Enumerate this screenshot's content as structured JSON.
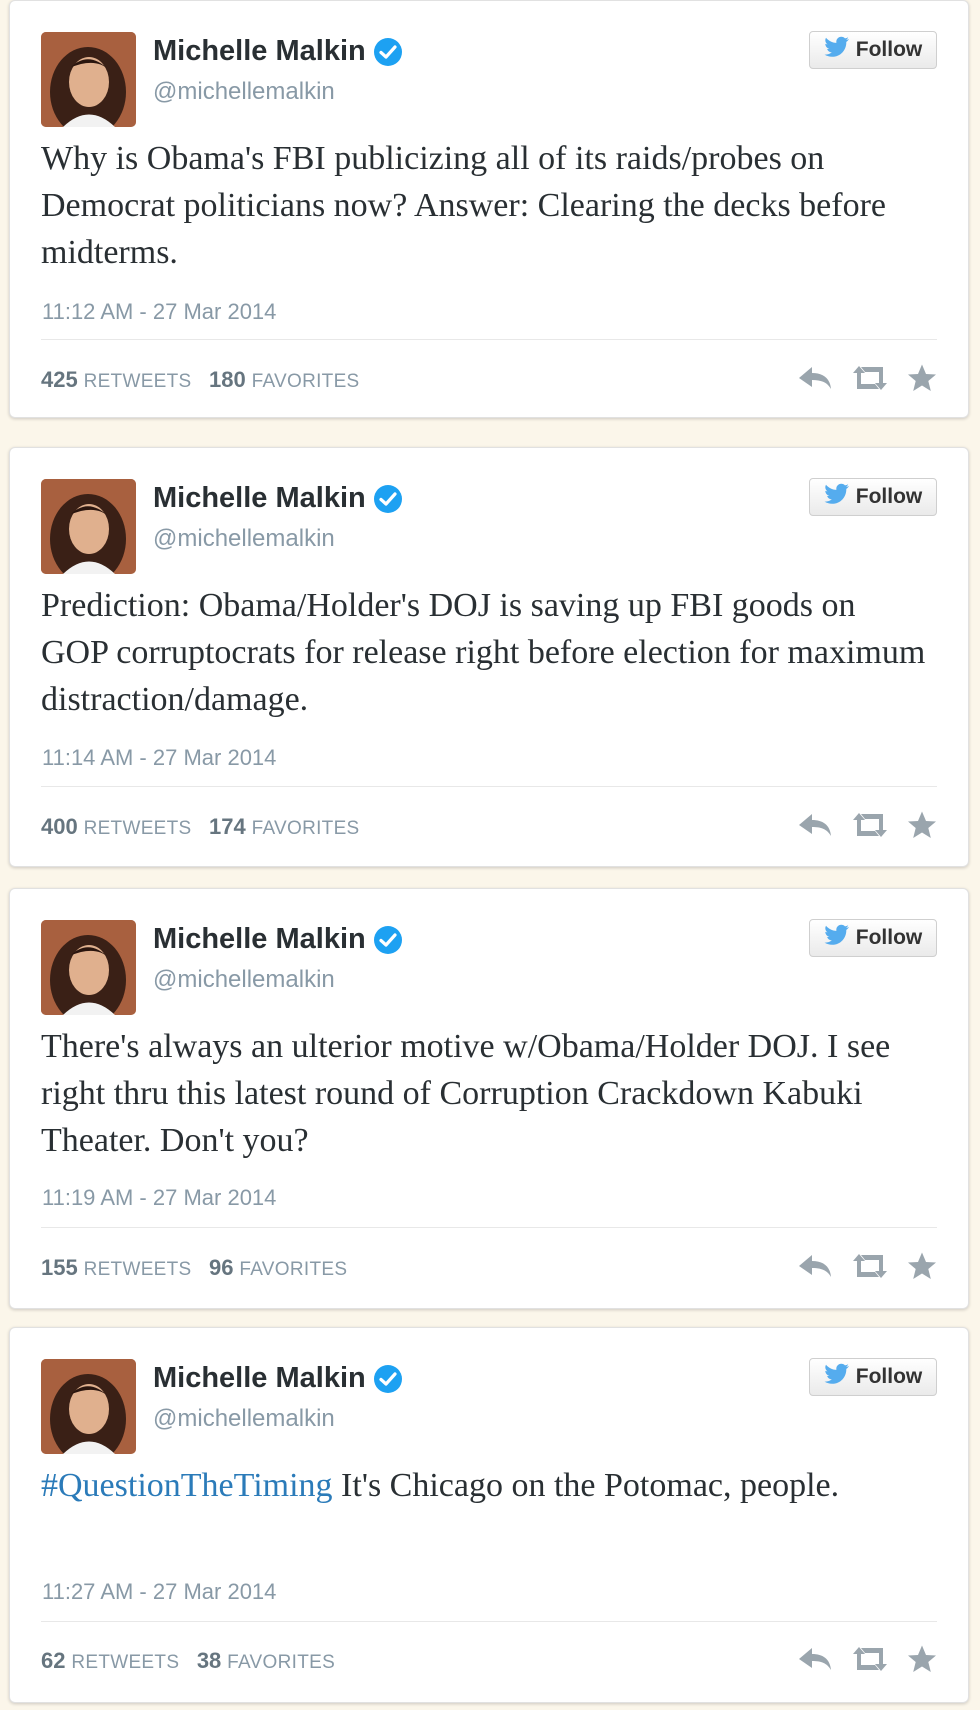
{
  "tweets": [
    {
      "name": "Michelle Malkin",
      "handle": "@michellemalkin",
      "follow_label": "Follow",
      "hashtag": "",
      "text": "Why is Obama's FBI publicizing all of its raids/probes on Democrat politicians now? Answer: Clearing the decks before midterms.",
      "timestamp": "11:12 AM - 27 Mar 2014",
      "retweets": "425",
      "retweets_label": "RETWEETS",
      "favorites": "180",
      "favorites_label": "FAVORITES"
    },
    {
      "name": "Michelle Malkin",
      "handle": "@michellemalkin",
      "follow_label": "Follow",
      "hashtag": "",
      "text": "Prediction: Obama/Holder's DOJ is saving up FBI goods on GOP corruptocrats for release right before election for maximum distraction/damage.",
      "timestamp": "11:14 AM - 27 Mar 2014",
      "retweets": "400",
      "retweets_label": "RETWEETS",
      "favorites": "174",
      "favorites_label": "FAVORITES"
    },
    {
      "name": "Michelle Malkin",
      "handle": "@michellemalkin",
      "follow_label": "Follow",
      "hashtag": "",
      "text": "There's always an ulterior motive w/Obama/Holder DOJ. I see right thru this latest round of Corruption Crackdown Kabuki Theater. Don't you?",
      "timestamp": "11:19 AM - 27 Mar 2014",
      "retweets": "155",
      "retweets_label": "RETWEETS",
      "favorites": "96",
      "favorites_label": "FAVORITES"
    },
    {
      "name": "Michelle Malkin",
      "handle": "@michellemalkin",
      "follow_label": "Follow",
      "hashtag": "#QuestionTheTiming",
      "text": " It's Chicago on the Potomac, people.",
      "timestamp": "11:27 AM - 27 Mar 2014",
      "retweets": "62",
      "retweets_label": "RETWEETS",
      "favorites": "38",
      "favorites_label": "FAVORITES"
    }
  ],
  "colors": {
    "background": "#fbf6ea",
    "verified": "#1da1f2",
    "twitter_bird": "#55acee",
    "hashtag": "#2b7bb9",
    "muted": "#8899a6"
  },
  "icons": [
    "avatar",
    "verified-badge-icon",
    "twitter-bird-icon",
    "reply-icon",
    "retweet-icon",
    "favorite-star-icon"
  ]
}
